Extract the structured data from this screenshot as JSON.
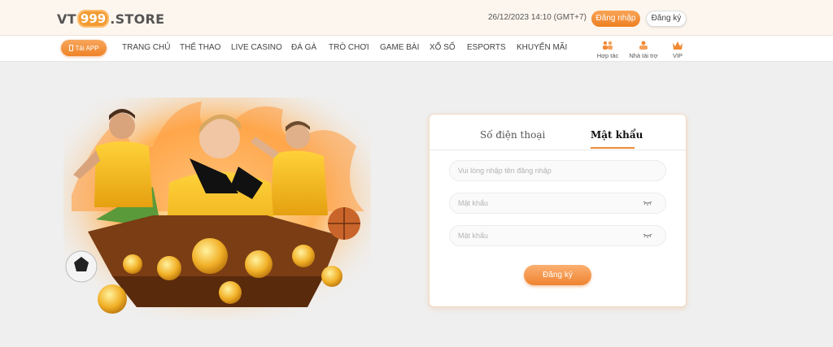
{
  "header": {
    "logo_prefix": "VT",
    "logo_number": "999",
    "logo_suffix": ".STORE",
    "datetime": "26/12/2023 14:10  (GMT+7)",
    "login_label": "Đăng nhập",
    "register_label": "Đăng ký"
  },
  "nav": {
    "app_button_label": "Tải APP",
    "items": [
      "TRANG CHỦ",
      "THỂ THAO",
      "LIVE CASINO",
      "ĐÁ GÀ",
      "TRÒ CHƠI",
      "GAME BÀI",
      "XỔ SỐ",
      "ESPORTS",
      "KHUYẾN MÃI"
    ],
    "shortcuts": [
      {
        "label": "Hợp tác",
        "icon": "partners-icon"
      },
      {
        "label": "Nhà tài trợ",
        "icon": "sponsor-icon"
      },
      {
        "label": "VIP",
        "icon": "crown-icon"
      }
    ]
  },
  "form": {
    "tabs": [
      "Số điện thoại",
      "Mật khẩu"
    ],
    "active_tab": 1,
    "username_placeholder": "Vui lòng nhập tên đăng nhập",
    "password_placeholder": "Mật khẩu",
    "confirm_placeholder": "Mật khẩu",
    "submit_label": "Đăng ký"
  },
  "colors": {
    "accent": "#ee8330",
    "topbar_bg": "#fdf6ee",
    "page_bg": "#efefef"
  }
}
